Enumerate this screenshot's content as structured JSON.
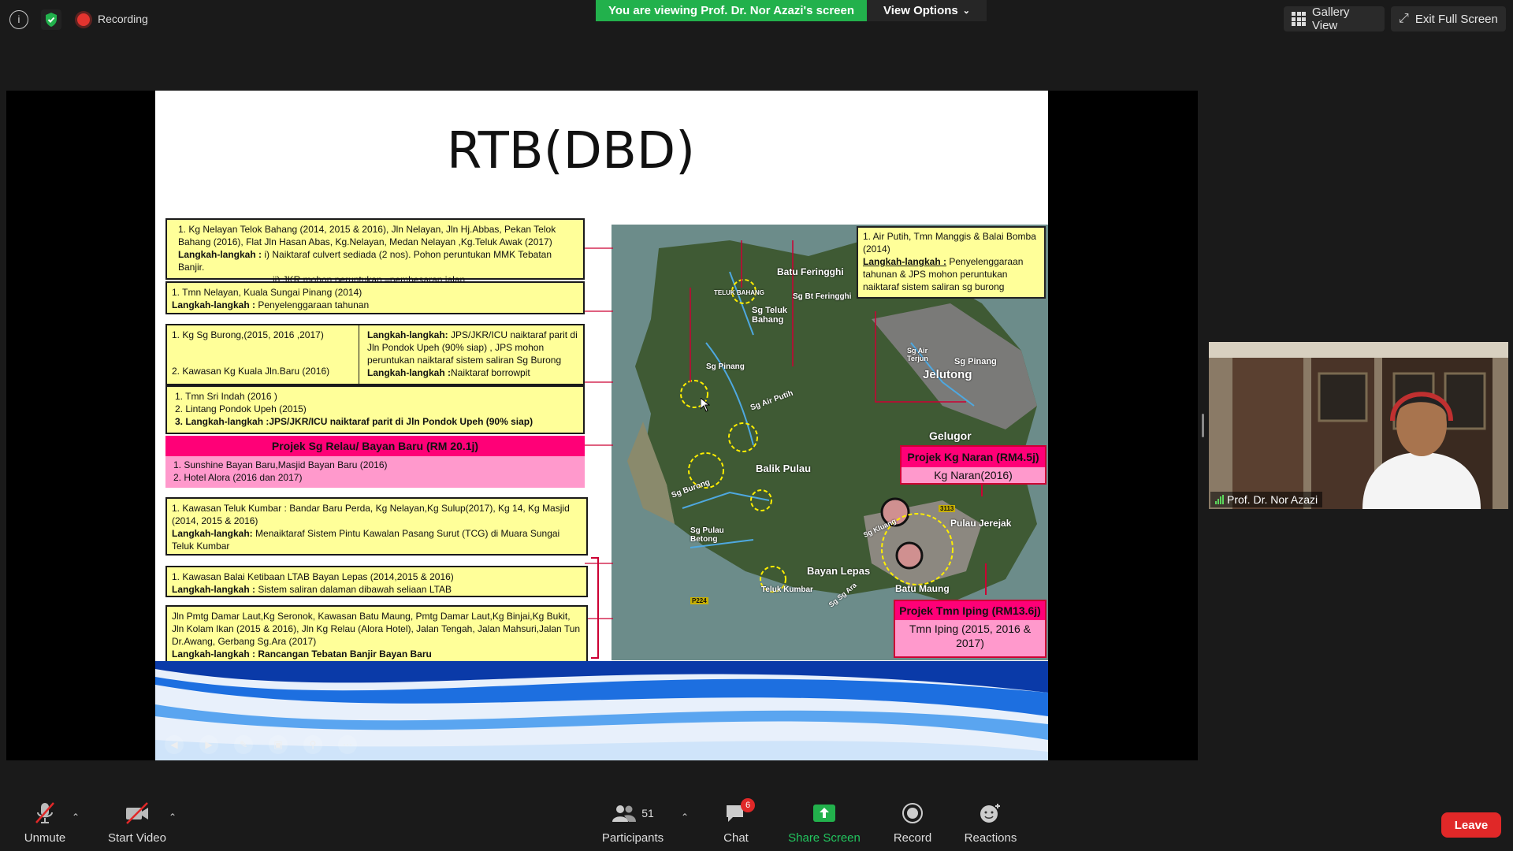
{
  "top_bar": {
    "recording_label": "Recording",
    "viewing_banner": "You are viewing Prof. Dr. Nor Azazi's screen",
    "view_options_label": "View Options",
    "gallery_view_label": "Gallery View",
    "exit_full_screen_label": "Exit Full Screen"
  },
  "slide": {
    "title": "RTB(DBD)",
    "boxes": {
      "b1_line1": "1. Kg Nelayan Telok Bahang (2014, 2015 & 2016), Jln Nelayan, Jln Hj.Abbas, Pekan Telok Bahang (2016), Flat Jln Hasan Abas, Kg.Nelayan, Medan Nelayan ,Kg.Teluk Awak (2017)",
      "b1_lk": "Langkah-langkah :",
      "b1_lk_text": "i) Naiktaraf culvert sediada (2 nos). Pohon peruntukan MMK Tebatan Banjir.",
      "b1_lk_text2": "ii) JKR mohon peruntukan –pembesaran jalan",
      "b2_line1": "1. Tmn Nelayan, Kuala Sungai Pinang (2014)",
      "b2_lk": "Langkah-langkah :",
      "b2_lk_text": "Penyelenggaraan tahunan",
      "b3_left1": "1. Kg Sg Burong,(2015, 2016 ,2017)",
      "b3_left2": "2. Kawasan Kg Kuala Jln.Baru (2016)",
      "b3_right_lk": "Langkah-langkah:",
      "b3_right_text": "JPS/JKR/ICU naiktaraf parit di Jln Pondok Upeh (90% siap) , JPS mohon peruntukan naiktaraf sistem saliran Sg Burong",
      "b3_right_lk2": "Langkah-langkah :",
      "b3_right_text2": "Naiktaraf borrowpit",
      "b4_1": "1. Tmn Sri Indah (2016 )",
      "b4_2": "2. Lintang Pondok Upeh (2015)",
      "b4_3": "3. Langkah-langkah :JPS/JKR/ICU naiktaraf parit di Jln Pondok Upeh (90% siap)",
      "relau_header": "Projek Sg Relau/ Bayan Baru (RM 20.1j)",
      "relau_1": "1. Sunshine Bayan Baru,Masjid Bayan Baru (2016)",
      "relau_2": "2. Hotel Alora (2016 dan 2017)",
      "b5_1": "1. Kawasan Teluk Kumbar : Bandar Baru Perda, Kg Nelayan,Kg Sulup(2017), Kg 14, Kg Masjid (2014, 2015 & 2016)",
      "b5_lk": "Langkah-langkah:",
      "b5_lk_text": "Menaiktaraf Sistem Pintu Kawalan Pasang Surut (TCG) di Muara Sungai Teluk Kumbar",
      "b6_1": "1. Kawasan Balai Ketibaan LTAB Bayan Lepas (2014,2015 & 2016)",
      "b6_lk": "Langkah-langkah :",
      "b6_lk_text": "Sistem saliran dalaman dibawah seliaan LTAB",
      "b7_1": "Jln Pmtg Damar Laut,Kg Seronok, Kawasan Batu Maung, Pmtg Damar Laut,Kg Binjai,Kg Bukit, Jln Kolam Ikan (2015 & 2016), Jln Kg Relau (Alora Hotel), Jalan Tengah, Jalan Mahsuri,Jalan Tun Dr.Awang, Gerbang Sg.Ara (2017)",
      "b7_lk": "Langkah-langkah : Rancangan Tebatan Banjir Bayan Baru"
    },
    "map_callouts": {
      "air_putih_1": "1. Air Putih, Tmn Manggis & Balai Bomba (2014)",
      "air_putih_lk": "Langkah-langkah :",
      "air_putih_text": "Penyelenggaraan tahunan & JPS mohon peruntukan naiktaraf sistem saliran sg burong",
      "naran_header": "Projek Kg Naran (RM4.5j)",
      "naran_text": "Kg Naran(2016)",
      "iping_header": "Projek Tmn Iping (RM13.6j)",
      "iping_text": "Tmn Iping (2015, 2016 & 2017)"
    },
    "map_labels": {
      "batu_ferringhi": "Batu Feringghi",
      "telok_bahang": "TELUK BAHANG",
      "sg_teluk_bahang": "Sg Teluk Bahang",
      "sg_bt_feringghi": "Sg Bt Feringghi",
      "sg_pinang_w": "Sg Pinang",
      "sg_air_putih": "Sg Air Putih",
      "sg_air_terjun": "Sg Air Terjun",
      "sg_pinang_e": "Sg Pinang",
      "jelutong": "Jelutong",
      "gelugor": "Gelugor",
      "balik_pulau": "Balik Pulau",
      "sg_burong": "Sg Burong",
      "sg_pulau_betong": "Sg Pulau Betong",
      "pulau_jerejak": "Pulau Jerejak",
      "bayan_lepas": "Bayan Lepas",
      "teluk_kumbar": "Teluk Kumbar",
      "batu_maung": "Batu Maung",
      "sg_kluang": "Sg Kluang",
      "sg_ara": "Sg Sg Ara",
      "p224": "P224",
      "r3113": "3113"
    }
  },
  "participant": {
    "name": "Prof. Dr. Nor Azazi"
  },
  "toolbar": {
    "unmute_label": "Unmute",
    "start_video_label": "Start Video",
    "participants_label": "Participants",
    "participants_count": "51",
    "chat_label": "Chat",
    "chat_badge": "6",
    "share_screen_label": "Share Screen",
    "record_label": "Record",
    "reactions_label": "Reactions",
    "leave_label": "Leave"
  },
  "colors": {
    "green_banner": "#22b14c",
    "leave_red": "#e02828",
    "box_yellow": "#ffff99",
    "pink_header": "#ff0077",
    "pink_box": "#ff99cc"
  }
}
